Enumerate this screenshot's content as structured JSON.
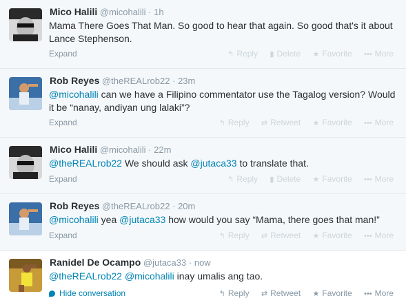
{
  "tweets": [
    {
      "fullname": "Mico Halili",
      "username": "@micohalili",
      "time": "1h",
      "text_parts": [
        {
          "t": "Mama There Goes That Man. So good to hear that again. So good that's it about Lance Stephenson.",
          "m": false
        }
      ],
      "expand": "Expand",
      "actions": [
        "Reply",
        "Delete",
        "Favorite",
        "More"
      ]
    },
    {
      "fullname": "Rob Reyes",
      "username": "@theREALrob22",
      "time": "23m",
      "text_parts": [
        {
          "t": "@micohalili",
          "m": true
        },
        {
          "t": " can we have a Filipino commentator use the Tagalog version? Would it be “nanay, andiyan ung lalaki”?",
          "m": false
        }
      ],
      "expand": "Expand",
      "actions": [
        "Reply",
        "Retweet",
        "Favorite",
        "More"
      ]
    },
    {
      "fullname": "Mico Halili",
      "username": "@micohalili",
      "time": "22m",
      "text_parts": [
        {
          "t": "@theREALrob22",
          "m": true
        },
        {
          "t": " We should ask ",
          "m": false
        },
        {
          "t": "@jutaca33",
          "m": true
        },
        {
          "t": " to translate that.",
          "m": false
        }
      ],
      "expand": "Expand",
      "actions": [
        "Reply",
        "Delete",
        "Favorite",
        "More"
      ]
    },
    {
      "fullname": "Rob Reyes",
      "username": "@theREALrob22",
      "time": "20m",
      "text_parts": [
        {
          "t": "@micohalili",
          "m": true
        },
        {
          "t": " yea ",
          "m": false
        },
        {
          "t": "@jutaca33",
          "m": true
        },
        {
          "t": " how would you say “Mama, there goes that man!”",
          "m": false
        }
      ],
      "expand": "Expand",
      "actions": [
        "Reply",
        "Retweet",
        "Favorite",
        "More"
      ]
    },
    {
      "fullname": "Ranidel De Ocampo",
      "username": "@jutaca33",
      "time": "now",
      "text_parts": [
        {
          "t": "@theREALrob22",
          "m": true
        },
        {
          "t": " ",
          "m": false
        },
        {
          "t": "@micohalili",
          "m": true
        },
        {
          "t": " inay umalis ang tao.",
          "m": false
        }
      ],
      "expand": "Hide conversation",
      "actions": [
        "Reply",
        "Retweet",
        "Favorite",
        "More"
      ]
    }
  ],
  "separator": "·",
  "colors": {
    "link": "#0084b4",
    "muted": "#8899a6",
    "faded": "#ccd6dd"
  }
}
